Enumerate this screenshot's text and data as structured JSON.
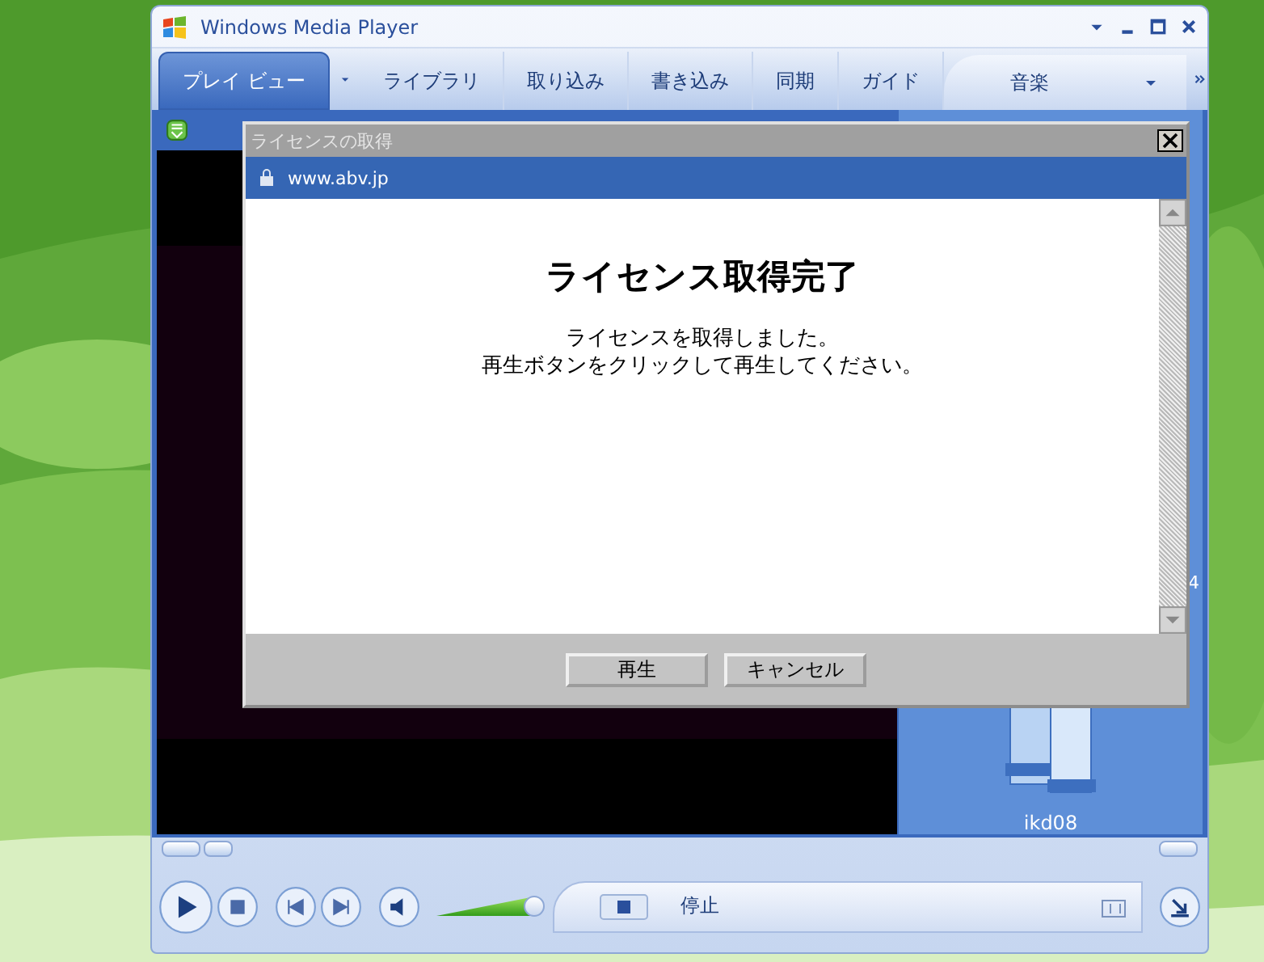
{
  "window": {
    "title": "Windows Media Player"
  },
  "tabs": [
    {
      "label": "プレイ ビュー",
      "selected": true
    },
    {
      "label": "ライブラリ",
      "selected": false
    },
    {
      "label": "取り込み",
      "selected": false
    },
    {
      "label": "書き込み",
      "selected": false
    },
    {
      "label": "同期",
      "selected": false
    },
    {
      "label": "ガイド",
      "selected": false
    }
  ],
  "media_tab": {
    "label": "音楽"
  },
  "side_pane": {
    "fragment": "4",
    "item": "ikd08"
  },
  "player": {
    "status": "停止",
    "volume": {
      "level": 0.92
    }
  },
  "dialog": {
    "title": "ライセンスの取得",
    "url": "www.abv.jp",
    "heading": "ライセンス取得完了",
    "message": [
      "ライセンスを取得しました。",
      "再生ボタンをクリックして再生してください。"
    ],
    "buttons": [
      "再生",
      "キャンセル"
    ]
  }
}
